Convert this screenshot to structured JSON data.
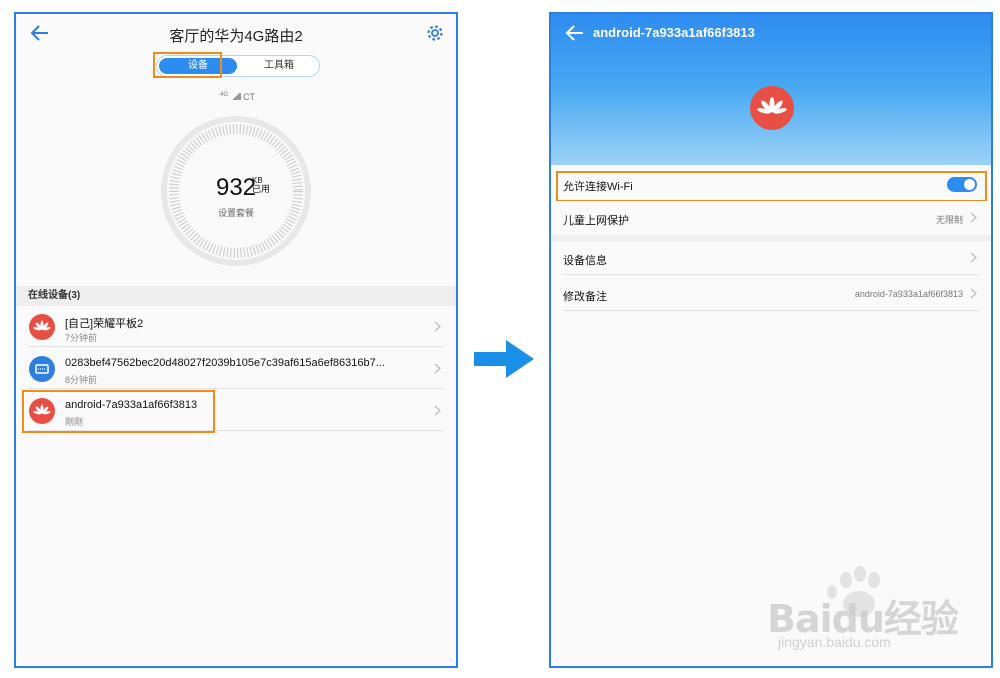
{
  "left": {
    "title": "客厅的华为4G路由2",
    "tabs": [
      {
        "label": "设备",
        "active": true
      },
      {
        "label": "工具箱",
        "active": false
      }
    ],
    "signal": {
      "network": "4G",
      "carrier": "CT"
    },
    "usage": {
      "value": "932",
      "unit_top": "KB",
      "unit_bottom": "已用",
      "sub": "设置套餐"
    },
    "section_title": "在线设备(3)",
    "devices": [
      {
        "name": "[自己]荣耀平板2",
        "time": "7分钟前",
        "icon": "huawei-logo-icon",
        "color": "#e84f44"
      },
      {
        "name": "0283bef47562bec20d48027f2039b105e7c39af615a6ef86316b7...",
        "time": "8分钟前",
        "icon": "router-icon",
        "color": "#2d7fe0"
      },
      {
        "name": "android-7a933a1af66f3813",
        "time": "刚刚",
        "icon": "huawei-logo-icon",
        "color": "#e84f44"
      }
    ]
  },
  "right": {
    "title": "android-7a933a1af66f3813",
    "rows": [
      {
        "label": "允许连接Wi-Fi",
        "toggle": true
      },
      {
        "label": "儿童上网保护",
        "value": "无限制"
      },
      {
        "label": "设备信息",
        "value": ""
      },
      {
        "label": "修改备注",
        "value": "android-7a933a1af66f3813"
      }
    ]
  },
  "colors": {
    "accent": "#2d8cf0",
    "highlight": "#f08c1c",
    "huawei": "#e84f44"
  },
  "watermark": {
    "main": "Baidu经验",
    "sub": "jingyan.baidu.com"
  }
}
